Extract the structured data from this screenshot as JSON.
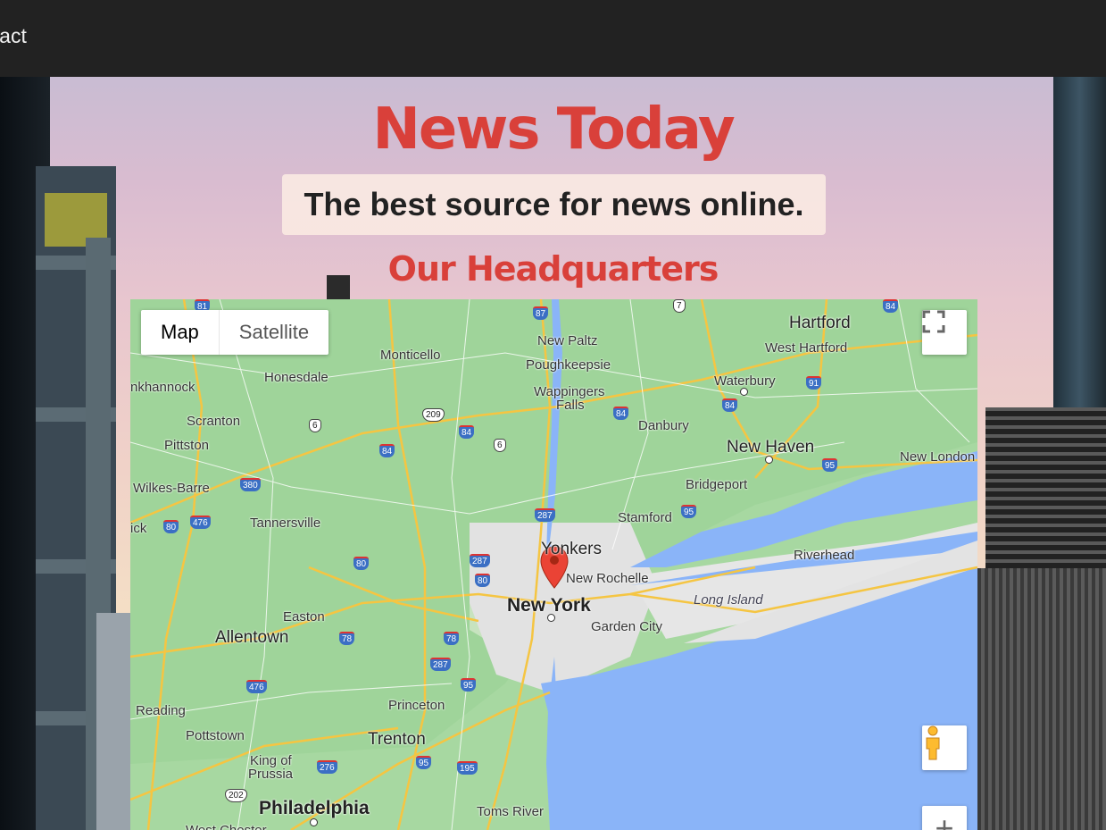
{
  "nav": {
    "contact_label": "ntact"
  },
  "header": {
    "site_title": "News Today",
    "tagline": "The best source for news online.",
    "section_title": "Our Headquarters"
  },
  "map": {
    "type_buttons": [
      "Map",
      "Satellite"
    ],
    "active_type": "Map",
    "marker_city": "New York",
    "places": {
      "hartford": "Hartford",
      "west_hartford": "West Hartford",
      "new_paltz": "New Paltz",
      "monticello": "Monticello",
      "poughkeepsie": "Poughkeepsie",
      "honesdale": "Honesdale",
      "wappingers_falls_1": "Wappingers",
      "wappingers_falls_2": "Falls",
      "waterbury": "Waterbury",
      "tunkhannock": "nkhannock",
      "scranton": "Scranton",
      "danbury": "Danbury",
      "pittston": "Pittston",
      "new_haven": "New Haven",
      "new_london": "New London",
      "wilkes_barre": "Wilkes-Barre",
      "bridgeport": "Bridgeport",
      "tannersville": "Tannersville",
      "stamford": "Stamford",
      "hazleton": "ick",
      "yonkers": "Yonkers",
      "new_rochelle": "New Rochelle",
      "riverhead": "Riverhead",
      "long_island": "Long Island",
      "easton": "Easton",
      "new_york": "New York",
      "garden_city": "Garden City",
      "allentown": "Allentown",
      "reading": "Reading",
      "princeton": "Princeton",
      "pottstown": "Pottstown",
      "trenton": "Trenton",
      "king_of_prussia_1": "King of",
      "king_of_prussia_2": "Prussia",
      "philadelphia": "Philadelphia",
      "toms_river": "Toms River",
      "west_chester": "West Chester"
    },
    "routes": {
      "r81": "81",
      "r87": "87",
      "r7": "7",
      "r84ne": "84",
      "r91": "91",
      "r84ct": "84",
      "r209": "209",
      "r6a": "6",
      "r84a": "84",
      "r84b": "84",
      "r6b": "6",
      "r84c": "84",
      "r380": "380",
      "r476a": "476",
      "r80a": "80",
      "r287a": "287",
      "r95a": "95",
      "r95b": "95",
      "r287b": "287",
      "r80b": "80",
      "r80c": "80",
      "r78a": "78",
      "r78b": "78",
      "r287c": "287",
      "r476b": "476",
      "r95c": "95",
      "r276": "276",
      "r95d": "95",
      "r195": "195",
      "r202": "202"
    }
  }
}
